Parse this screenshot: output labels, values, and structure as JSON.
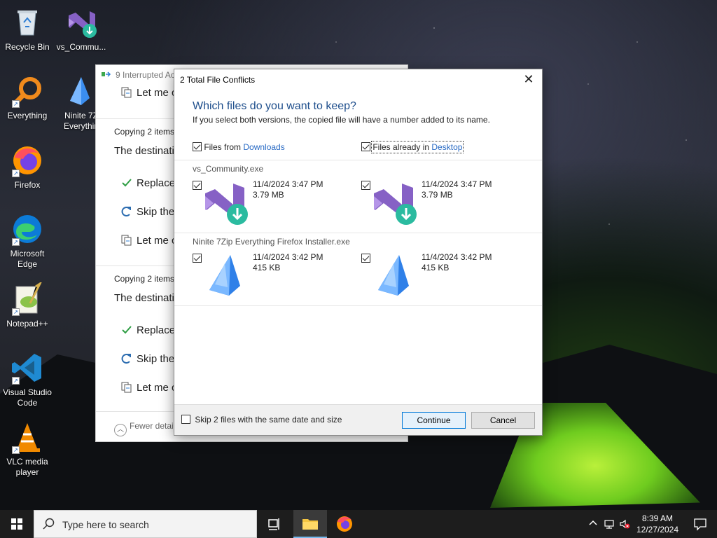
{
  "desktop": {
    "icons": [
      {
        "label": "Recycle Bin"
      },
      {
        "label": "vs_Commu..."
      },
      {
        "label": "Everything"
      },
      {
        "label": "Ninite 7Z Everythin"
      },
      {
        "label": "Firefox"
      },
      {
        "label": "Microsoft Edge"
      },
      {
        "label": "Notepad++"
      },
      {
        "label": "Visual Studio Code"
      },
      {
        "label": "VLC media player"
      }
    ]
  },
  "bg_window": {
    "title": "9 Interrupted Ac",
    "rows": {
      "let_me_top": "Let me c",
      "copying_1": "Copying 2 items",
      "dest_1": "The destinati",
      "replace_1": "Replace",
      "skip_1": "Skip the",
      "letme_1": "Let me c",
      "copying_2": "Copying 2 items",
      "dest_2": "The destinati",
      "replace_2": "Replace",
      "skip_2": "Skip the",
      "letme_2": "Let me c",
      "fewer": "Fewer detail"
    }
  },
  "dialog": {
    "title": "2 Total File Conflicts",
    "close_glyph": "✕",
    "heading": "Which files do you want to keep?",
    "subheading": "If you select both versions, the copied file will have a number added to its name.",
    "left_header_prefix": "Files from ",
    "left_header_link": "Downloads",
    "right_header_prefix": "Files already in ",
    "right_header_link": "Desktop",
    "files": [
      {
        "name": "vs_Community.exe",
        "left": {
          "date": "11/4/2024 3:47 PM",
          "size": "3.79 MB",
          "icon": "visual-studio-installer-icon"
        },
        "right": {
          "date": "11/4/2024 3:47 PM",
          "size": "3.79 MB",
          "icon": "visual-studio-installer-icon"
        }
      },
      {
        "name": "Ninite 7Zip Everything Firefox Installer.exe",
        "left": {
          "date": "11/4/2024 3:42 PM",
          "size": "415 KB",
          "icon": "ninite-icon"
        },
        "right": {
          "date": "11/4/2024 3:42 PM",
          "size": "415 KB",
          "icon": "ninite-icon"
        }
      }
    ],
    "skip_label": "Skip 2 files with the same date and size",
    "continue_label": "Continue",
    "cancel_label": "Cancel"
  },
  "taskbar": {
    "search_placeholder": "Type here to search",
    "time": "8:39 AM",
    "date": "12/27/2024"
  },
  "colors": {
    "accent": "#0078d7",
    "heading": "#1e4e8c",
    "link": "#2769c4"
  }
}
